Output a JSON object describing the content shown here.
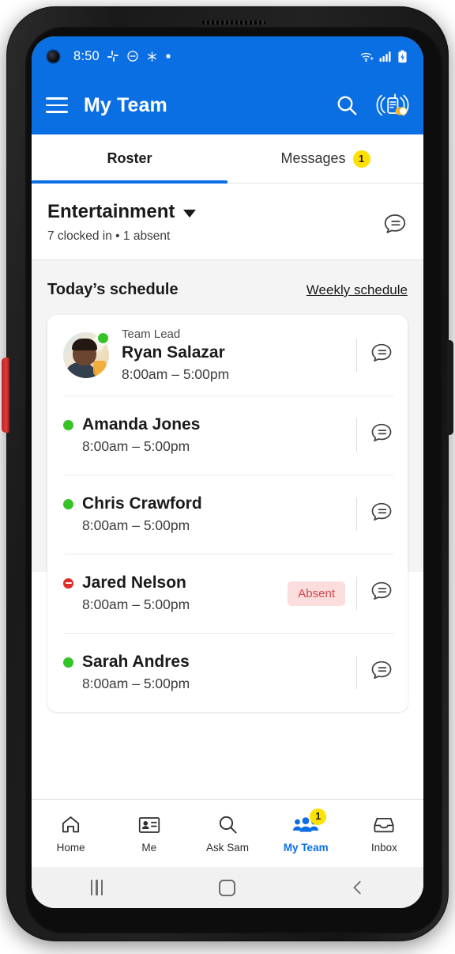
{
  "status_bar": {
    "time": "8:50",
    "left_icons": [
      "slack-icon",
      "do-not-disturb-icon",
      "snowflake-icon",
      "dot-icon"
    ],
    "right_icons": [
      "wifi-icon",
      "cell-signal-icon",
      "battery-charging-icon"
    ]
  },
  "app_bar": {
    "menu_icon": "hamburger-menu-icon",
    "title": "My Team",
    "search_icon": "search-icon",
    "walkie_icon": "walkie-talkie-icon"
  },
  "tabs": [
    {
      "label": "Roster",
      "active": true,
      "badge": ""
    },
    {
      "label": "Messages",
      "active": false,
      "badge": "1"
    }
  ],
  "team": {
    "name": "Entertainment",
    "summary": "7 clocked in  •  1 absent",
    "message_icon": "message-bubble-icon"
  },
  "schedule": {
    "title": "Today’s schedule",
    "link": "Weekly schedule",
    "rows": [
      {
        "role": "Team Lead",
        "name": "Ryan Salazar",
        "time": "8:00am – 5:00pm",
        "status": "present",
        "badge": "",
        "has_avatar": true
      },
      {
        "role": "",
        "name": "Amanda Jones",
        "time": "8:00am – 5:00pm",
        "status": "present",
        "badge": "",
        "has_avatar": false
      },
      {
        "role": "",
        "name": "Chris Crawford",
        "time": "8:00am – 5:00pm",
        "status": "present",
        "badge": "",
        "has_avatar": false
      },
      {
        "role": "",
        "name": "Jared Nelson",
        "time": "8:00am – 5:00pm",
        "status": "absent",
        "badge": "Absent",
        "has_avatar": false
      },
      {
        "role": "",
        "name": "Sarah Andres",
        "time": "8:00am – 5:00pm",
        "status": "present",
        "badge": "",
        "has_avatar": false
      }
    ]
  },
  "bottom_nav": [
    {
      "label": "Home",
      "icon": "home-icon",
      "active": false,
      "badge": ""
    },
    {
      "label": "Me",
      "icon": "id-card-icon",
      "active": false,
      "badge": ""
    },
    {
      "label": "Ask Sam",
      "icon": "search-icon",
      "active": false,
      "badge": ""
    },
    {
      "label": "My Team",
      "icon": "people-icon",
      "active": true,
      "badge": "1"
    },
    {
      "label": "Inbox",
      "icon": "inbox-icon",
      "active": false,
      "badge": ""
    }
  ],
  "system_nav": {
    "recents": "recents-icon",
    "home": "home-square-icon",
    "back": "back-chevron-icon"
  },
  "colors": {
    "brand_blue": "#0b6fe4",
    "badge_yellow": "#ffe100",
    "present_green": "#35c327",
    "absent_red": "#e02b2b",
    "absent_badge_bg": "#fbdddd"
  }
}
